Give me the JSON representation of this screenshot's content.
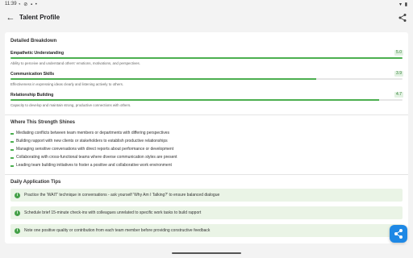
{
  "status": {
    "time": "11:39"
  },
  "header": {
    "title": "Talent Profile"
  },
  "breakdown": {
    "title": "Detailed Breakdown",
    "metrics": [
      {
        "name": "Empathetic Understanding",
        "score": "5.0",
        "fraction": 1.0,
        "desc": "Ability to perceive and understand others' emotions, motivations, and perspectives."
      },
      {
        "name": "Communication Skills",
        "score": "3.9",
        "fraction": 0.78,
        "desc": "Effectiveness in expressing ideas clearly and listening actively to others."
      },
      {
        "name": "Relationship Building",
        "score": "4.7",
        "fraction": 0.94,
        "desc": "Capacity to develop and maintain strong, productive connections with others."
      }
    ]
  },
  "shines": {
    "title": "Where This Strength Shines",
    "items": [
      "Mediating conflicts between team members or departments with differing perspectives",
      "Building rapport with new clients or stakeholders to establish productive relationships",
      "Managing sensitive conversations with direct reports about performance or development",
      "Collaborating with cross-functional teams where diverse communication styles are present",
      "Leading team building initiatives to foster a positive and collaborative work environment"
    ]
  },
  "tips": {
    "title": "Daily Application Tips",
    "items": [
      "Practice the 'WAIT' technique in conversations - ask yourself 'Why Am I Talking?' to ensure balanced dialogue",
      "Schedule brief 15-minute check-ins with colleagues unrelated to specific work tasks to build rapport",
      "Note one positive quality or contribution from each team member before providing constructive feedback"
    ]
  },
  "colors": {
    "accent": "#4caf50",
    "fab": "#1e88e5",
    "tip_bg": "#eaf4e6"
  },
  "icons": {
    "back": "arrow-back-icon",
    "share": "share-icon",
    "tip": "info-icon",
    "fab": "share-icon"
  }
}
